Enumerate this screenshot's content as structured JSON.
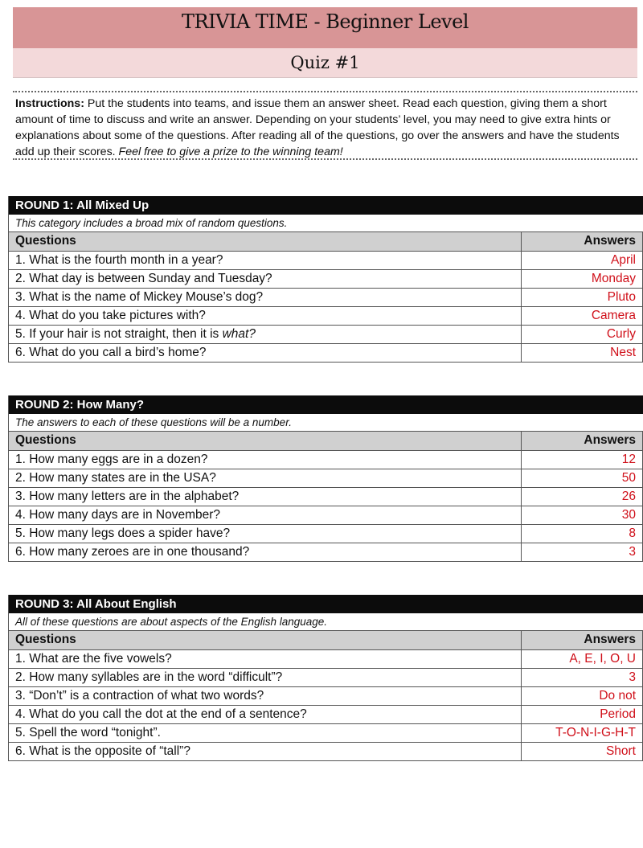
{
  "header": {
    "title": "TRIVIA TIME - Beginner Level",
    "subtitle": "Quiz #1",
    "title_bg": "#d89596",
    "subtitle_bg": "#f3d9da"
  },
  "instructions": {
    "label": "Instructions:",
    "body": " Put the students into teams, and issue them an answer sheet. Read each question, giving them a short amount of time to discuss and write an answer. Depending on your students’ level, you may need to give extra hints or explanations about some of the questions. After reading all of the questions, go over the answers and have the students add up their scores. ",
    "italic_tail": "Feel free to give a prize to the winning team!"
  },
  "table_headers": {
    "questions": "Questions",
    "answers": "Answers"
  },
  "answer_color": "#d0101a",
  "rounds": [
    {
      "title": "ROUND 1: All Mixed Up",
      "description": "This category includes a broad mix of random questions.",
      "rows": [
        {
          "q": "1. What is the fourth month in a year?",
          "a": "April"
        },
        {
          "q": "2. What day is between Sunday and Tuesday?",
          "a": "Monday"
        },
        {
          "q": "3. What is the name of Mickey Mouse’s dog?",
          "a": "Pluto"
        },
        {
          "q": "4. What do you take pictures with?",
          "a": "Camera"
        },
        {
          "q": "5. If your hair is not straight, then it is ",
          "q_italic": "what?",
          "a": "Curly"
        },
        {
          "q": "6. What do you call a bird’s home?",
          "a": "Nest"
        }
      ]
    },
    {
      "title": "ROUND 2: How Many?",
      "description": "The answers to each of these questions will be a number.",
      "rows": [
        {
          "q": "1. How many eggs are in a dozen?",
          "a": "12"
        },
        {
          "q": "2. How many states are in the USA?",
          "a": "50"
        },
        {
          "q": "3. How many letters are in the alphabet?",
          "a": "26"
        },
        {
          "q": "4. How many days are in November?",
          "a": "30"
        },
        {
          "q": "5. How many legs does a spider have?",
          "a": "8"
        },
        {
          "q": "6. How many zeroes are in one thousand?",
          "a": "3"
        }
      ]
    },
    {
      "title": "ROUND 3: All About English",
      "description": "All of these questions are about aspects of the English language.",
      "rows": [
        {
          "q": "1. What are the five vowels?",
          "a": "A, E, I, O, U"
        },
        {
          "q": "2. How many syllables are in the word “difficult”?",
          "a": "3"
        },
        {
          "q": "3. “Don’t” is a contraction of what two words?",
          "a": "Do not"
        },
        {
          "q": "4. What do you call the dot at the end of a sentence?",
          "a": "Period"
        },
        {
          "q": "5. Spell the word “tonight”.",
          "a": "T-O-N-I-G-H-T"
        },
        {
          "q": "6. What is the opposite of “tall”?",
          "a": "Short"
        }
      ]
    }
  ]
}
